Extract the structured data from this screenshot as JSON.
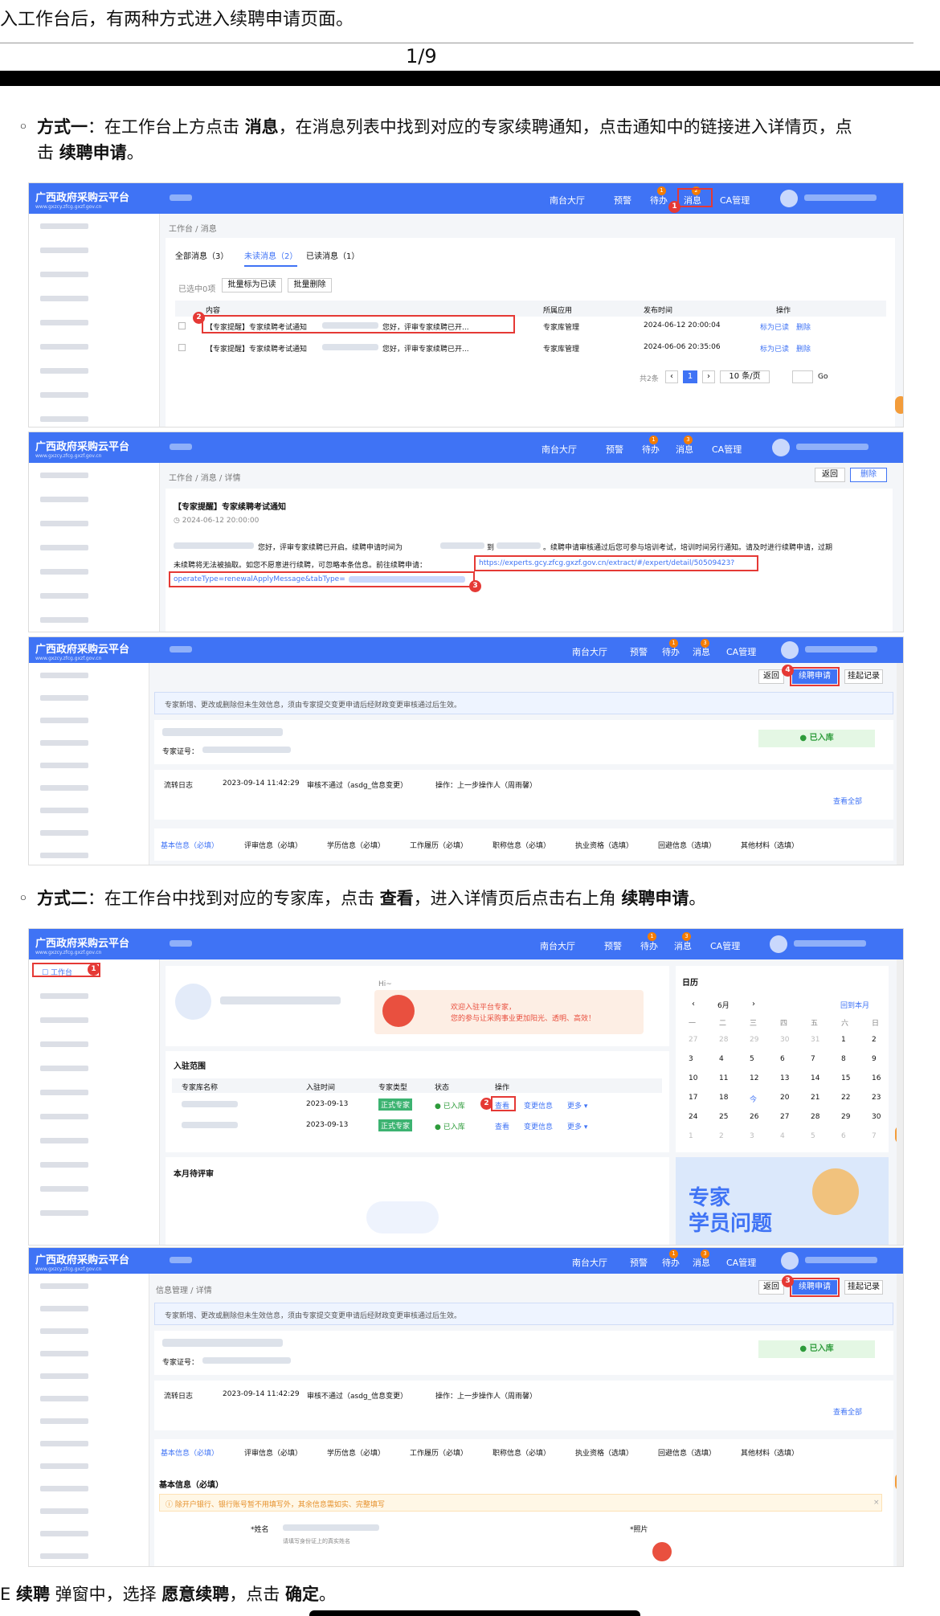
{
  "intro": "入工作台后，有两种方式进入续聘申请页面。",
  "page_number": "1/9",
  "method1": {
    "bullet": "◦",
    "label": "方式一",
    "t1": "：在工作台上方点击 ",
    "k1": "消息",
    "t2": "，在消息列表中找到对应的专家续聘通知，点击通知中的链接进入详情页，点",
    "t3": "击 ",
    "k2": "续聘申请",
    "t4": "。"
  },
  "method2": {
    "bullet": "◦",
    "label": "方式二",
    "t1": "：在工作台中找到对应的专家库，点击 ",
    "k1": "查看",
    "t2": "，进入详情页后点击右上角 ",
    "k2": "续聘申请",
    "t3": "。"
  },
  "footer": {
    "t1": "E ",
    "k1": "续聘",
    "t2": " 弹窗中，选择 ",
    "k2": "愿意续聘",
    "t3": "，点击 ",
    "k3": "确定",
    "t4": "。"
  },
  "nav": {
    "logo": "广西政府采购云平台",
    "logo_sub": "www.gxzcy.zfcg.gxzf.gov.cn",
    "hall": "南台大厅",
    "warn": "预警",
    "todo": "待办",
    "msg": "消息",
    "ca": "CA管理",
    "badge1": "1",
    "badge2": "2",
    "badge3": "3"
  },
  "shot1": {
    "crumb": "工作台 / 消息",
    "tab_all": "全部消息（3）",
    "tab_unread": "未读消息（2）",
    "tab_read": "已读消息（1）",
    "selected": "已选中0项",
    "mark_read": "批量标为已读",
    "bulk_delete": "批量删除",
    "col_content": "内容",
    "col_app": "所属应用",
    "col_time": "发布时间",
    "col_op": "操作",
    "rows": [
      {
        "content": "【专家提醒】专家续聘考试通知",
        "tail": "您好，评审专家续聘已开...",
        "app": "专家库管理",
        "time": "2024-06-12 20:00:04",
        "op1": "标为已读",
        "op2": "删除"
      },
      {
        "content": "【专家提醒】专家续聘考试通知",
        "tail": "您好，评审专家续聘已开...",
        "app": "专家库管理",
        "time": "2024-06-06 20:35:06",
        "op1": "标为已读",
        "op2": "删除"
      }
    ],
    "total": "共2条",
    "page": "1",
    "per_page": "10 条/页",
    "go": "Go"
  },
  "shot2": {
    "crumb": "工作台 / 消息 / 详情",
    "back": "返回",
    "delete": "删除",
    "title": "【专家提醒】专家续聘考试通知",
    "date": "◷ 2024-06-12 20:00:00",
    "body1a": "您好，评审专家续聘已开启。续聘申请时间为",
    "body1b": "到",
    "body1c": "。续聘申请审核通过后您可参与培训考试，培训时间另行通知。请及时进行续聘申请，过期",
    "body2": "未续聘将无法被抽取。如您不愿意进行续聘，可忽略本条信息。前往续聘申请：",
    "link1": "https://experts.gcy.zfcg.gxzf.gov.cn/extract/#/expert/detail/50509423?",
    "link2": "operateType=renewalApplyMessage&tabType="
  },
  "shot3": {
    "back": "返回",
    "renew": "续聘申请",
    "history": "挂起记录",
    "notice": "专家新增、更改或删除但未生效信息，须由专家提交变更申请后经财政变更审核通过后生效。",
    "cert": "专家证号：",
    "status": "● 已入库",
    "log": "流转日志",
    "log_time": "2023-09-14 11:42:29",
    "log_text": "审核不通过（asdg_信息变更）",
    "log_op": "操作：上一步操作人（周雨馨）",
    "view_all": "查看全部",
    "tabs": [
      "基本信息（必填）",
      "评审信息（必填）",
      "学历信息（必填）",
      "工作履历（必填）",
      "职称信息（必填）",
      "执业资格（选填）",
      "回避信息（选填）",
      "其他材料（选填）"
    ]
  },
  "shot4": {
    "workbench": "工作台",
    "hello": "Hi~",
    "welcome1": "欢迎入驻平台专家，",
    "welcome2": "您的参与让采购事业更加阳光、透明、高效！",
    "scope_title": "入驻范围",
    "cols": [
      "专家库名称",
      "入驻时间",
      "专家类型",
      "状态",
      "操作"
    ],
    "rows": [
      {
        "date": "2023-09-13",
        "type": "正式专家",
        "status": "● 已入库",
        "view": "查看",
        "change": "变更信息",
        "more": "更多 ▾"
      },
      {
        "date": "2023-09-13",
        "type": "正式专家",
        "status": "● 已入库",
        "view": "查看",
        "change": "变更信息",
        "more": "更多 ▾"
      }
    ],
    "pending": "本月待评审",
    "cal_title": "日历",
    "month": "6月",
    "back_month": "回到本月",
    "weekdays": [
      "一",
      "二",
      "三",
      "四",
      "五",
      "六",
      "日"
    ],
    "days": [
      [
        "27",
        "28",
        "29",
        "30",
        "31",
        "1",
        "2"
      ],
      [
        "3",
        "4",
        "5",
        "6",
        "7",
        "8",
        "9"
      ],
      [
        "10",
        "11",
        "12",
        "13",
        "14",
        "15",
        "16"
      ],
      [
        "17",
        "18",
        "今",
        "20",
        "21",
        "22",
        "23"
      ],
      [
        "24",
        "25",
        "26",
        "27",
        "28",
        "29",
        "30"
      ],
      [
        "1",
        "2",
        "3",
        "4",
        "5",
        "6",
        "7"
      ]
    ],
    "banner": "专家",
    "banner2": "学员问题"
  },
  "shot5": {
    "crumb": "信息管理 / 详情",
    "section": "基本信息（必填）",
    "warning": "ⓘ 除开户银行、银行账号暂不用填写外，其余信息需如实、完整填写",
    "name_label": "*姓名",
    "name_hint": "请填写身份证上的真实姓名",
    "photo_label": "*照片"
  }
}
